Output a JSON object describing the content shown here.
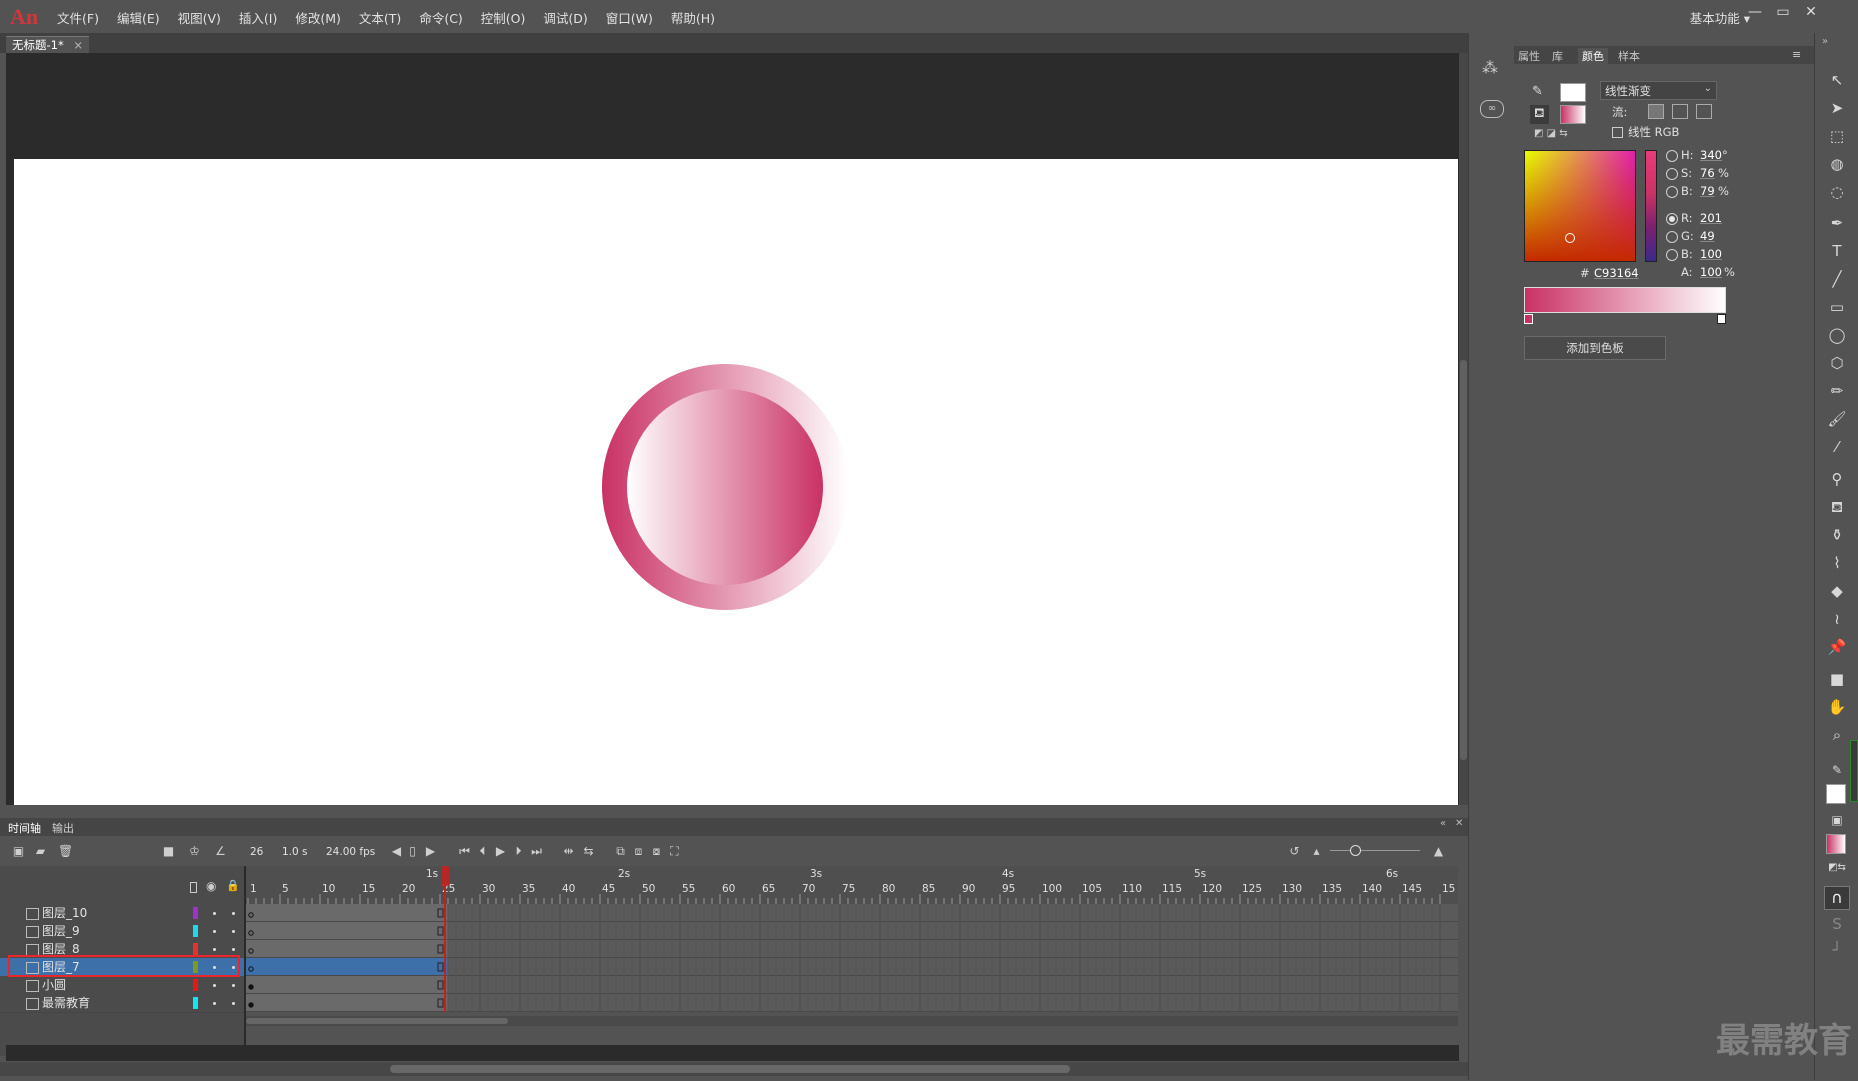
{
  "app": {
    "logo": "An",
    "menu": [
      "文件(F)",
      "编辑(E)",
      "视图(V)",
      "插入(I)",
      "修改(M)",
      "文本(T)",
      "命令(C)",
      "控制(O)",
      "调试(D)",
      "窗口(W)",
      "帮助(H)"
    ],
    "workspace": "基本功能",
    "win_min": "—",
    "win_max": "▭",
    "win_close": "✕"
  },
  "document": {
    "tab_title": "无标题-1*",
    "tab_close": "×"
  },
  "colors": {
    "gradient_start": "#c93164",
    "gradient_end": "#ffffff",
    "stage_bg": "#ffffff",
    "highlight_box": "#e8262b",
    "selected_layer": "#3d6fa8"
  },
  "timeline": {
    "tabs": [
      "时间轴",
      "输出"
    ],
    "current_frame": "26",
    "elapsed": "1.0 s",
    "fps": "24.00 fps",
    "ruler_seconds": [
      "1s",
      "2s",
      "3s",
      "4s",
      "5s",
      "6s"
    ],
    "ruler_frames": [
      "1",
      "5",
      "10",
      "15",
      "20",
      "25",
      "30",
      "35",
      "40",
      "45",
      "50",
      "55",
      "60",
      "65",
      "70",
      "75",
      "80",
      "85",
      "90",
      "95",
      "100",
      "105",
      "110",
      "115",
      "120",
      "125",
      "130",
      "135",
      "140",
      "145",
      "15"
    ],
    "layers": [
      {
        "name": "图层_10",
        "color": "#a030d0",
        "selected": false
      },
      {
        "name": "图层_9",
        "color": "#20d8e8",
        "selected": false
      },
      {
        "name": "图层_8",
        "color": "#e83030",
        "selected": false
      },
      {
        "name": "图层_7",
        "color": "#7a9a20",
        "selected": true
      },
      {
        "name": "小圆",
        "color": "#e81818",
        "selected": false
      },
      {
        "name": "最需教育",
        "color": "#10e8f0",
        "selected": false
      }
    ]
  },
  "color_panel": {
    "tabs": [
      "属性",
      "库",
      "颜色",
      "样本"
    ],
    "active_tab": "颜色",
    "fill_type": "线性渐变",
    "flow_label": "流:",
    "linear_rgb": "线性 RGB",
    "hsb": {
      "H_label": "H:",
      "H": "340",
      "H_unit": "°",
      "S_label": "S:",
      "S": "76",
      "S_unit": "%",
      "B_label": "B:",
      "B": "79",
      "B_unit": "%"
    },
    "rgb": {
      "R_label": "R:",
      "R": "201",
      "G_label": "G:",
      "G": "49",
      "B_label": "B:",
      "B": "100"
    },
    "hex_label": "#",
    "hex": "C93164",
    "alpha_label": "A:",
    "alpha": "100",
    "alpha_unit": "%",
    "add_swatch": "添加到色板"
  },
  "watermark": "最需教育"
}
